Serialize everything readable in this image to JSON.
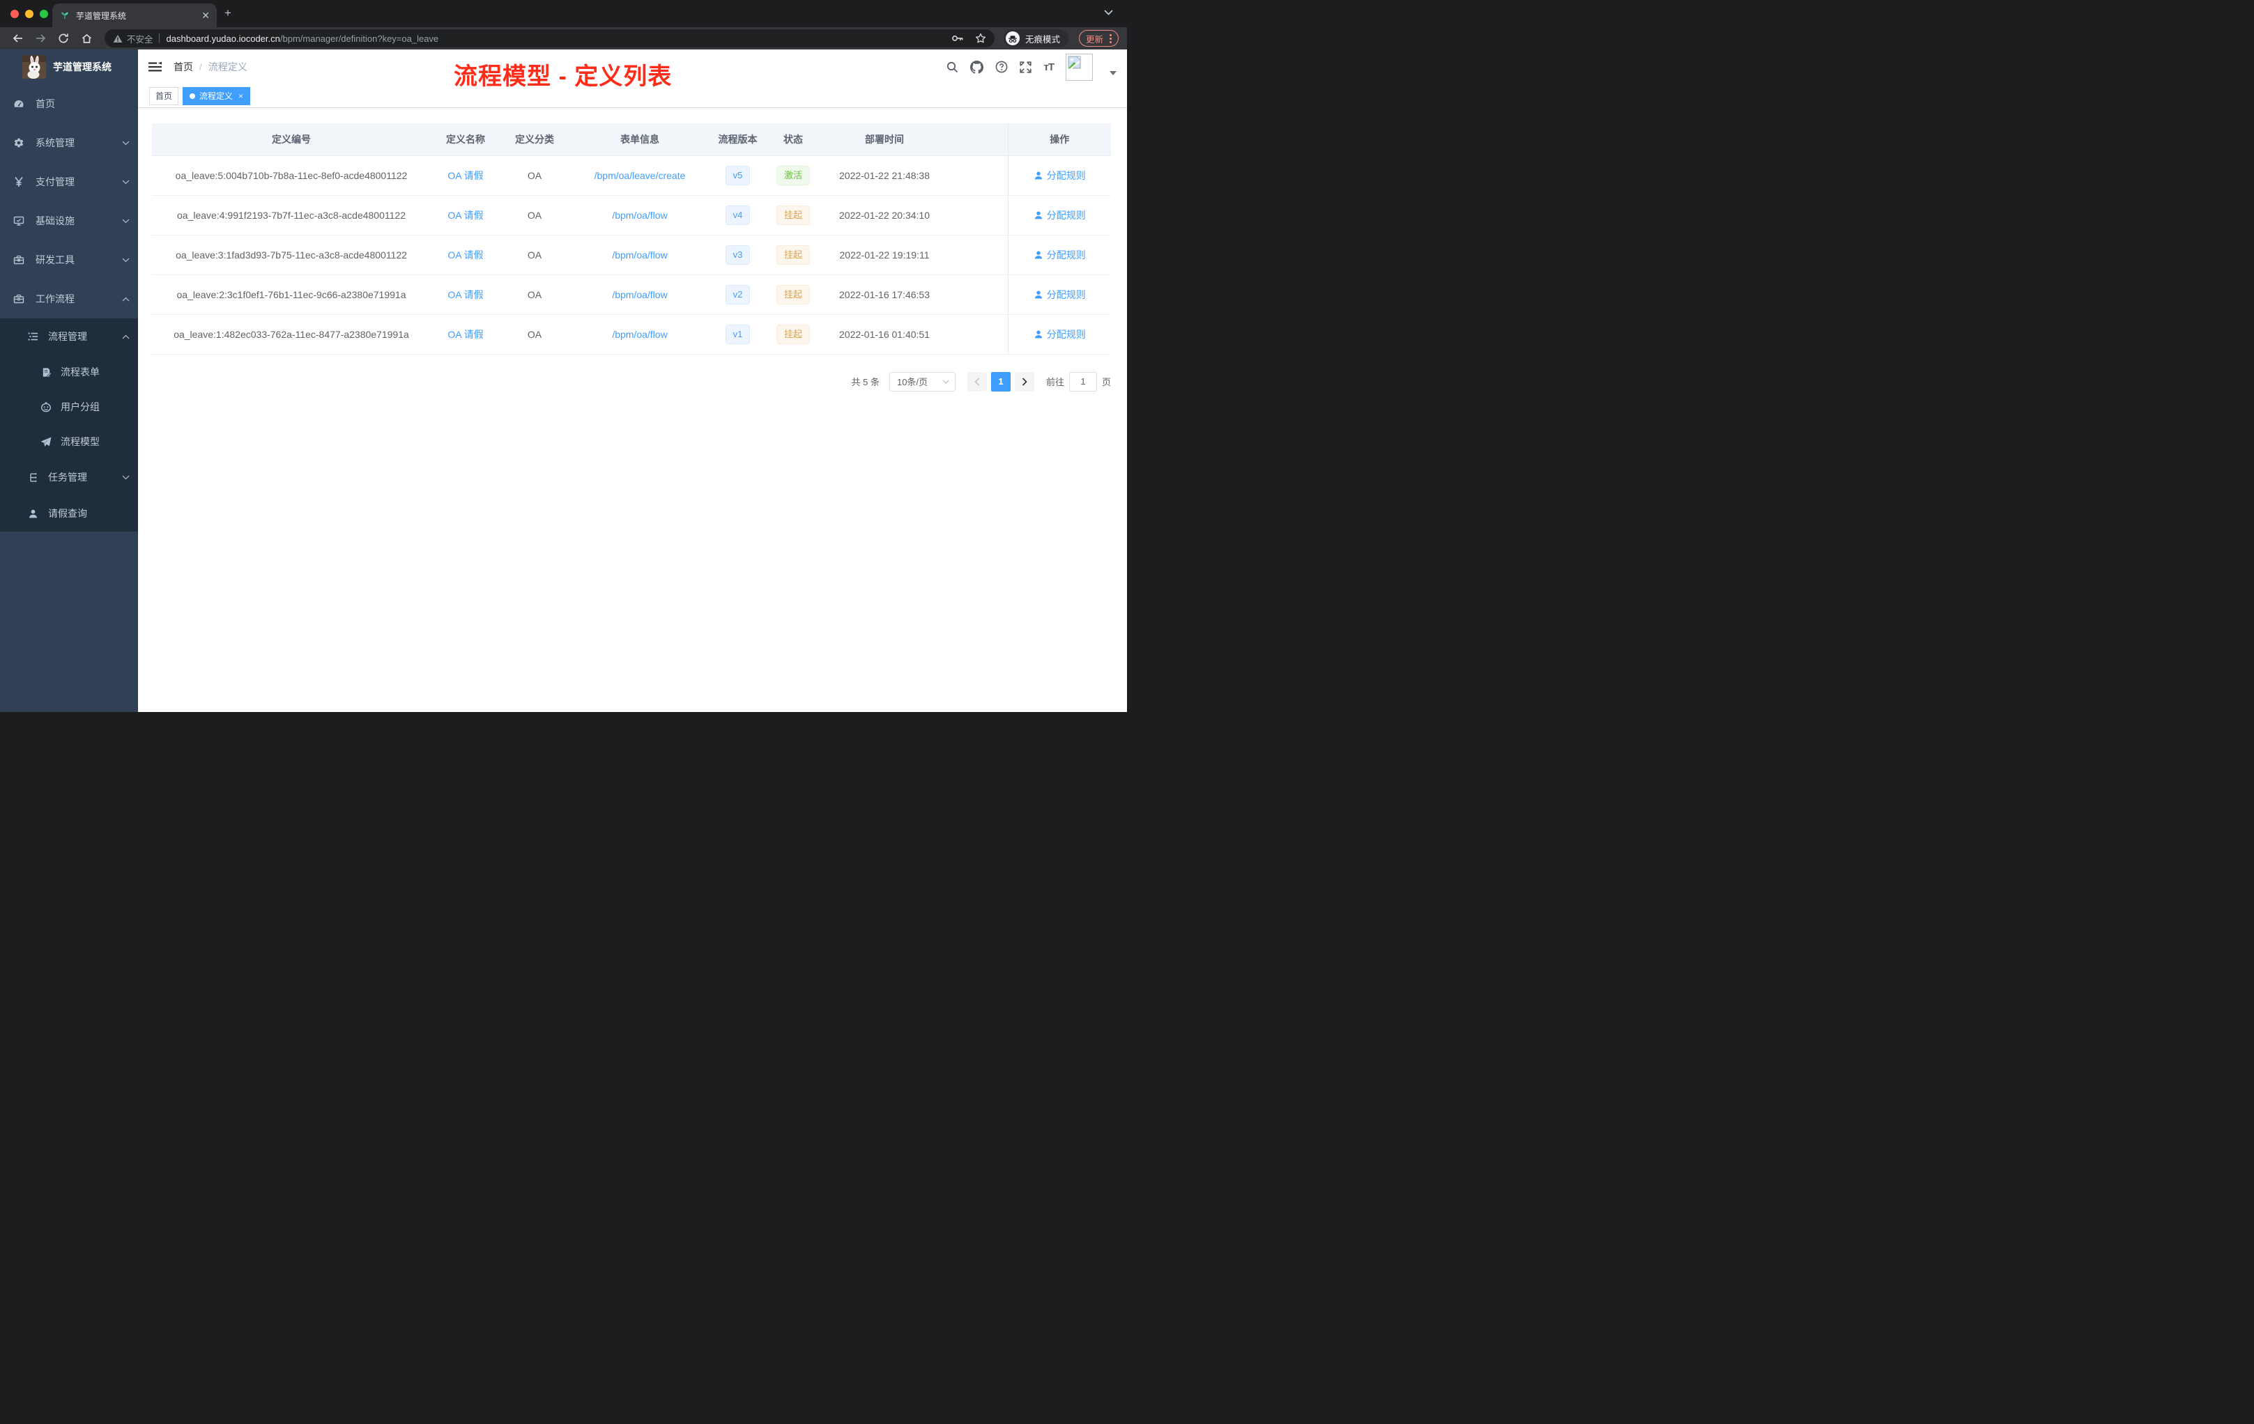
{
  "browser": {
    "tab_title": "芋道管理系统",
    "new_tab": "+",
    "security_label": "不安全",
    "url_host": "dashboard.yudao.iocoder.cn",
    "url_path": "/bpm/manager/definition?key=oa_leave",
    "incognito_label": "无痕模式",
    "update_label": "更新"
  },
  "sidebar": {
    "app_title": "芋道管理系统",
    "menu": {
      "home": "首页",
      "system": "系统管理",
      "payment": "支付管理",
      "infra": "基础设施",
      "devtools": "研发工具",
      "workflow": "工作流程",
      "process_mgmt": "流程管理",
      "process_form": "流程表单",
      "user_group": "用户分组",
      "process_model": "流程模型",
      "task_mgmt": "任务管理",
      "leave_query": "请假查询"
    }
  },
  "header": {
    "breadcrumb_home": "首页",
    "breadcrumb_sep": "/",
    "breadcrumb_current": "流程定义",
    "annotation": "流程模型 - 定义列表"
  },
  "tags": {
    "home": "首页",
    "current": "流程定义",
    "close": "×"
  },
  "table": {
    "columns": {
      "id": "定义编号",
      "name": "定义名称",
      "category": "定义分类",
      "form": "表单信息",
      "version": "流程版本",
      "status": "状态",
      "deploy_time": "部署时间",
      "actions": "操作"
    },
    "action_label": "分配规则",
    "rows": [
      {
        "id": "oa_leave:5:004b710b-7b8a-11ec-8ef0-acde48001122",
        "name": "OA 请假",
        "category": "OA",
        "form": "/bpm/oa/leave/create",
        "version": "v5",
        "status": "激活",
        "deploy_time": "2022-01-22 21:48:38"
      },
      {
        "id": "oa_leave:4:991f2193-7b7f-11ec-a3c8-acde48001122",
        "name": "OA 请假",
        "category": "OA",
        "form": "/bpm/oa/flow",
        "version": "v4",
        "status": "挂起",
        "deploy_time": "2022-01-22 20:34:10"
      },
      {
        "id": "oa_leave:3:1fad3d93-7b75-11ec-a3c8-acde48001122",
        "name": "OA 请假",
        "category": "OA",
        "form": "/bpm/oa/flow",
        "version": "v3",
        "status": "挂起",
        "deploy_time": "2022-01-22 19:19:11"
      },
      {
        "id": "oa_leave:2:3c1f0ef1-76b1-11ec-9c66-a2380e71991a",
        "name": "OA 请假",
        "category": "OA",
        "form": "/bpm/oa/flow",
        "version": "v2",
        "status": "挂起",
        "deploy_time": "2022-01-16 17:46:53"
      },
      {
        "id": "oa_leave:1:482ec033-762a-11ec-8477-a2380e71991a",
        "name": "OA 请假",
        "category": "OA",
        "form": "/bpm/oa/flow",
        "version": "v1",
        "status": "挂起",
        "deploy_time": "2022-01-16 01:40:51"
      }
    ]
  },
  "pagination": {
    "total": "共 5 条",
    "page_size": "10条/页",
    "current_page": "1",
    "goto_label": "前往",
    "goto_value": "1",
    "page_unit": "页"
  },
  "colors": {
    "accent": "#409EFF",
    "annotation_red": "#FE2C19",
    "success": "#67C23A",
    "warning": "#E6A23C",
    "sidebar_bg": "#304156",
    "submenu_bg": "#1F2D3D"
  }
}
